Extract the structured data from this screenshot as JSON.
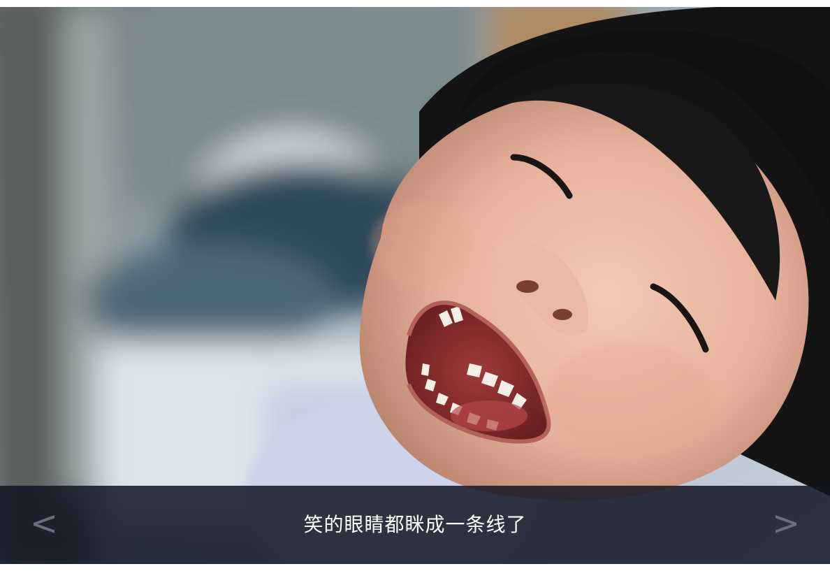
{
  "photo": {
    "subject": "laughing-child-photo"
  },
  "caption": {
    "text": "笑的眼睛都眯成一条线了"
  },
  "navigation": {
    "prev_label": "<",
    "next_label": ">"
  },
  "colors": {
    "caption_bar": "#14162a",
    "caption_text": "#ffffff",
    "nav_arrow": "#6b6e7e"
  }
}
